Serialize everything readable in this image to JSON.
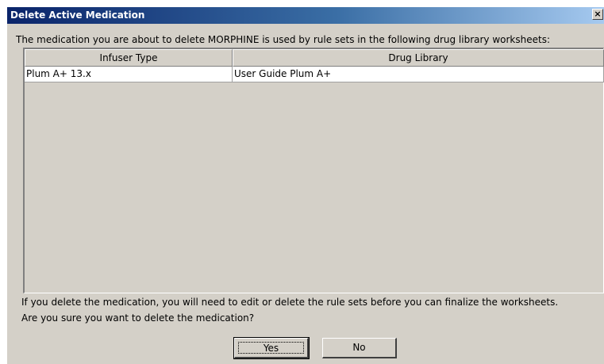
{
  "dialog": {
    "title": "Delete Active Medication",
    "close_symbol": "×",
    "intro_text": "The medication you are about to delete MORPHINE is used by rule sets in the following drug library worksheets:",
    "table": {
      "columns": [
        "Infuser Type",
        "Drug Library"
      ],
      "rows": [
        [
          "Plum A+ 13.x",
          "User Guide Plum A+"
        ]
      ]
    },
    "warning_line1": "If you delete the medication, you will need to edit or delete the rule sets before you can finalize the worksheets.",
    "warning_line2": "Are you sure you want to delete the medication?",
    "buttons": {
      "yes_label": "Yes",
      "no_label": "No"
    }
  }
}
